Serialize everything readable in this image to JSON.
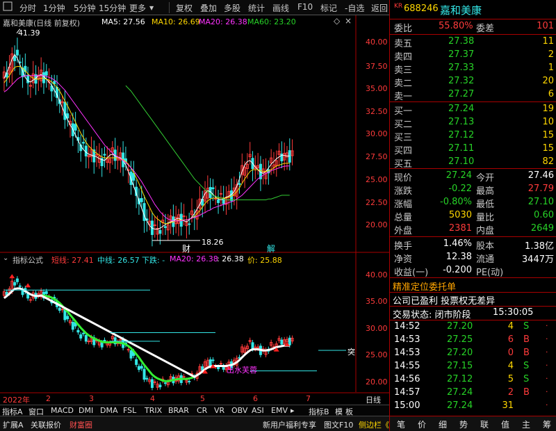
{
  "toolbar": {
    "left_icon": "square-icon",
    "items": [
      "分时",
      "1分钟",
      "5分钟",
      "15分钟",
      "更多",
      "复权",
      "叠加",
      "多股",
      "统计",
      "画线",
      "F10",
      "标记",
      "-自选",
      "返回"
    ]
  },
  "stock": {
    "badge": "KR",
    "code": "688246",
    "name": "嘉和美康"
  },
  "order_book": {
    "weibi_label": "委比",
    "weibi_value": "55.80%",
    "weicha_label": "委差",
    "weicha_value": "101",
    "asks": [
      {
        "label": "卖五",
        "price": "27.38",
        "vol": "11"
      },
      {
        "label": "卖四",
        "price": "27.37",
        "vol": "2"
      },
      {
        "label": "卖三",
        "price": "27.33",
        "vol": "1"
      },
      {
        "label": "卖二",
        "price": "27.32",
        "vol": "20"
      },
      {
        "label": "卖一",
        "price": "27.27",
        "vol": "6"
      }
    ],
    "bids": [
      {
        "label": "买一",
        "price": "27.24",
        "vol": "19"
      },
      {
        "label": "买二",
        "price": "27.13",
        "vol": "10"
      },
      {
        "label": "买三",
        "price": "27.12",
        "vol": "15"
      },
      {
        "label": "买四",
        "price": "27.11",
        "vol": "15"
      },
      {
        "label": "买五",
        "price": "27.10",
        "vol": "82"
      }
    ]
  },
  "quote": [
    {
      "l1": "现价",
      "v1": "27.24",
      "c1": "green",
      "l2": "今开",
      "v2": "27.46",
      "c2": "white"
    },
    {
      "l1": "涨跌",
      "v1": "-0.22",
      "c1": "green",
      "l2": "最高",
      "v2": "27.79",
      "c2": "red"
    },
    {
      "l1": "涨幅",
      "v1": "-0.80%",
      "c1": "green",
      "l2": "最低",
      "v2": "27.10",
      "c2": "green"
    },
    {
      "l1": "总量",
      "v1": "5030",
      "c1": "yellow",
      "l2": "量比",
      "v2": "0.60",
      "c2": "green"
    },
    {
      "l1": "外盘",
      "v1": "2381",
      "c1": "red",
      "l2": "内盘",
      "v2": "2649",
      "c2": "green"
    }
  ],
  "stats": [
    {
      "l1": "换手",
      "v1": "1.46%",
      "l2": "股本",
      "v2": "1.38亿"
    },
    {
      "l1": "净资",
      "v1": "12.38",
      "l2": "流通",
      "v2": "3447万"
    },
    {
      "l1": "收益(一)",
      "v1": "-0.200",
      "l2": "PE(动)",
      "v2": ""
    }
  ],
  "notices": {
    "title": "精准定位委托单",
    "line1": "公司已盈利 投票权无差异",
    "status_label": "交易状态: 闭市阶段",
    "status_time": "15:30:05"
  },
  "ticks": [
    {
      "time": "14:52",
      "price": "27.20",
      "vol": "4",
      "bs": "S"
    },
    {
      "time": "14:53",
      "price": "27.25",
      "vol": "6",
      "bs": "B"
    },
    {
      "time": "14:53",
      "price": "27.20",
      "vol": "0",
      "bs": "B"
    },
    {
      "time": "14:55",
      "price": "27.15",
      "vol": "4",
      "bs": "S"
    },
    {
      "time": "14:56",
      "price": "27.12",
      "vol": "5",
      "bs": "S"
    },
    {
      "time": "14:57",
      "price": "27.24",
      "vol": "2",
      "bs": "B"
    },
    {
      "time": "15:00",
      "price": "27.24",
      "vol": "31",
      "bs": ""
    }
  ],
  "right_tabs": [
    "笔",
    "价",
    "细",
    "势",
    "联",
    "值",
    "主",
    "筹"
  ],
  "main_chart": {
    "title": "嘉和美康(日线 前复权)",
    "ma5": "MA5: 27.56",
    "ma10": "MA10: 26.69",
    "ma20": "MA20: 26.38",
    "ma60": "MA60: 23.20",
    "high_marker": "41.39",
    "low_marker": "18.26",
    "tag_cai": "财",
    "tag_jie": "解",
    "y_ticks": [
      "40.00",
      "37.50",
      "35.00",
      "32.50",
      "30.00",
      "27.50",
      "25.00",
      "22.50",
      "20.00"
    ]
  },
  "sub_chart": {
    "title": "指标公式",
    "short_line": "短线: 27.41",
    "mid_line": "中线: 26.57",
    "down_trend": "下跌: -",
    "ma20": "MA20: 26.38",
    "extra": ": 26.38",
    "price": "价: 25.88",
    "annotation": "出水芙蓉",
    "right_label": "突",
    "y_ticks": [
      "40.00",
      "35.00",
      "30.00",
      "25.00",
      "20.00"
    ]
  },
  "x_axis": {
    "labels": [
      "2022年",
      "2",
      "3",
      "4",
      "5",
      "6",
      "7"
    ],
    "period": "日线"
  },
  "indicator_tabs": [
    "指标A",
    "窗口",
    "MACD",
    "DMI",
    "DMA",
    "FSL",
    "TRIX",
    "BRAR",
    "CR",
    "VR",
    "OBV",
    "ASI",
    "EMV"
  ],
  "indicator_tabs_right": [
    "指标B",
    "模",
    "板"
  ],
  "bottom_bar": [
    "扩展A",
    "关联报价",
    "财富圈"
  ],
  "bottom_right": [
    "新用户福利专享",
    "图文F10",
    "侧边栏《"
  ],
  "chart_data": {
    "type": "line",
    "title": "",
    "x": [
      0,
      1,
      2,
      3,
      4,
      5,
      6,
      7,
      8,
      9,
      10,
      11,
      12,
      13,
      14,
      15,
      16,
      17,
      18,
      19,
      20,
      21,
      22,
      23,
      24,
      25,
      26,
      27,
      28,
      29,
      30,
      31,
      32,
      33,
      34,
      35,
      36,
      37,
      38,
      39,
      40,
      41,
      42,
      43,
      44,
      45,
      46,
      47,
      48,
      49,
      50,
      51,
      52,
      53,
      54,
      55,
      56,
      57,
      58,
      59,
      60,
      61,
      62,
      63,
      64,
      65,
      66,
      67,
      68,
      69,
      70,
      71,
      72,
      73,
      74,
      75,
      76,
      77,
      78,
      79,
      80,
      81,
      82,
      83,
      84,
      85,
      86,
      87,
      88,
      89,
      90,
      91,
      92,
      93,
      94,
      95,
      96,
      97,
      98,
      99,
      100,
      101,
      102,
      103,
      104,
      105,
      106,
      107,
      108,
      109,
      110,
      111,
      112,
      113,
      114,
      115,
      116,
      117,
      118,
      119,
      120,
      121,
      122,
      123,
      124,
      125,
      126,
      127,
      128,
      129,
      130,
      131,
      132
    ],
    "series": [
      {
        "name": "MA5",
        "color": "#ffffff",
        "values": [
          36.0,
          36.6,
          37.3,
          38.1,
          38.6,
          38.2,
          37.5,
          36.8,
          36.1,
          35.7,
          35.6,
          35.8,
          36.0,
          36.3,
          36.4,
          36.2,
          35.9,
          35.6,
          35.2,
          34.7,
          34.2,
          33.5,
          32.8,
          32.1,
          31.5,
          30.9,
          30.4,
          29.8,
          29.2,
          28.6,
          28.2,
          27.9,
          27.7,
          27.6,
          27.5,
          27.4,
          27.2,
          27.1,
          27.0,
          27.3,
          27.6,
          27.7,
          27.5,
          27.4,
          27.3,
          27.0,
          26.5,
          25.8,
          25.0,
          24.2,
          23.4,
          22.6,
          21.8,
          21.0,
          20.4,
          19.9,
          19.6,
          19.5,
          19.5,
          19.6,
          19.8,
          20.0,
          20.2,
          20.3,
          20.4,
          20.6,
          20.7,
          20.5,
          20.4,
          20.3,
          20.5,
          20.8,
          21.2,
          21.7,
          22.2,
          22.8,
          23.4,
          23.7,
          23.6,
          23.3,
          23.0,
          22.8,
          22.7,
          22.8,
          23.0,
          23.1,
          23.3,
          23.6,
          24.2,
          25.0,
          25.8,
          26.5,
          26.9,
          27.0,
          26.7,
          26.3,
          26.0,
          25.7,
          25.6,
          25.8,
          26.2,
          26.6,
          26.9,
          27.2,
          27.4,
          27.6,
          27.56,
          27.5,
          27.5,
          27.5,
          27.5,
          27.5,
          27.5,
          27.5,
          27.5,
          27.5,
          27.5,
          27.5,
          27.5,
          27.5,
          27.5,
          27.5,
          27.5,
          27.5,
          27.5,
          27.5,
          27.5,
          27.5,
          27.5,
          27.5,
          27.5,
          27.5,
          27.5
        ]
      },
      {
        "name": "MA10",
        "color": "#ffd700",
        "values": [
          35.5,
          35.9,
          36.3,
          36.8,
          37.2,
          37.3,
          37.3,
          37.1,
          36.8,
          36.5,
          36.2,
          36.0,
          35.9,
          35.9,
          36.0,
          36.0,
          35.9,
          35.8,
          35.6,
          35.3,
          35.0,
          34.6,
          34.1,
          33.5,
          33.0,
          32.4,
          31.8,
          31.2,
          30.6,
          30.0,
          29.5,
          29.0,
          28.6,
          28.3,
          28.0,
          27.8,
          27.6,
          27.4,
          27.3,
          27.3,
          27.3,
          27.3,
          27.3,
          27.3,
          27.2,
          27.1,
          26.9,
          26.6,
          26.2,
          25.7,
          25.1,
          24.5,
          23.8,
          23.1,
          22.5,
          21.9,
          21.3,
          20.9,
          20.6,
          20.4,
          20.2,
          20.1,
          20.1,
          20.2,
          20.3,
          20.4,
          20.5,
          20.5,
          20.5,
          20.5,
          20.6,
          20.7,
          20.9,
          21.2,
          21.5,
          21.9,
          22.3,
          22.6,
          22.8,
          22.9,
          22.9,
          22.9,
          22.9,
          22.9,
          22.9,
          23.0,
          23.1,
          23.3,
          23.6,
          24.0,
          24.5,
          25.0,
          25.4,
          25.8,
          26.0,
          26.0,
          26.0,
          25.9,
          25.8,
          25.8,
          25.9,
          26.0,
          26.2,
          26.4,
          26.5,
          26.6,
          26.69,
          26.7,
          26.7,
          26.7,
          26.7,
          26.7,
          26.7,
          26.7,
          26.7,
          26.7,
          26.7,
          26.7,
          26.7,
          26.7,
          26.7,
          26.7,
          26.7,
          26.7,
          26.7,
          26.7,
          26.7,
          26.7,
          26.7,
          26.7,
          26.7,
          26.7,
          26.7
        ]
      },
      {
        "name": "MA20",
        "color": "#ff33ff",
        "values": [
          34.5,
          34.7,
          35.0,
          35.3,
          35.6,
          35.9,
          36.1,
          36.2,
          36.3,
          36.3,
          36.3,
          36.3,
          36.3,
          36.3,
          36.3,
          36.3,
          36.2,
          36.1,
          36.0,
          35.8,
          35.6,
          35.3,
          35.0,
          34.7,
          34.3,
          33.9,
          33.5,
          33.1,
          32.7,
          32.3,
          31.9,
          31.5,
          31.1,
          30.7,
          30.3,
          29.9,
          29.5,
          29.1,
          28.7,
          28.4,
          28.1,
          27.8,
          27.6,
          27.4,
          27.2,
          27.0,
          26.8,
          26.5,
          26.2,
          25.9,
          25.5,
          25.1,
          24.7,
          24.2,
          23.7,
          23.2,
          22.7,
          22.2,
          21.8,
          21.4,
          21.1,
          20.8,
          20.6,
          20.5,
          20.4,
          20.4,
          20.4,
          20.4,
          20.5,
          20.5,
          20.6,
          20.7,
          20.8,
          20.9,
          21.0,
          21.2,
          21.3,
          21.5,
          21.6,
          21.8,
          21.9,
          22.0,
          22.1,
          22.2,
          22.3,
          22.4,
          22.5,
          22.6,
          22.8,
          23.0,
          23.2,
          23.5,
          23.8,
          24.1,
          24.4,
          24.7,
          25.0,
          25.2,
          25.4,
          25.6,
          25.7,
          25.9,
          26.0,
          26.1,
          26.2,
          26.3,
          26.38,
          26.4,
          26.4,
          26.4,
          26.4,
          26.4,
          26.4,
          26.4,
          26.4,
          26.4,
          26.4,
          26.4,
          26.4,
          26.4,
          26.4,
          26.4,
          26.4,
          26.4,
          26.4,
          26.4,
          26.4,
          26.4,
          26.4,
          26.4,
          26.4,
          26.4,
          26.4
        ]
      },
      {
        "name": "MA60",
        "color": "#33cc33",
        "values": [
          null,
          null,
          null,
          null,
          null,
          null,
          null,
          null,
          null,
          null,
          null,
          null,
          null,
          null,
          null,
          null,
          null,
          null,
          null,
          null,
          null,
          null,
          null,
          null,
          null,
          null,
          null,
          null,
          null,
          null,
          null,
          null,
          null,
          null,
          null,
          null,
          null,
          null,
          null,
          null,
          null,
          null,
          null,
          null,
          null,
          null,
          35.2,
          34.9,
          34.6,
          34.2,
          33.8,
          33.4,
          33.0,
          32.6,
          32.2,
          31.8,
          31.4,
          31.0,
          30.6,
          30.2,
          29.8,
          29.4,
          29.0,
          28.6,
          28.2,
          27.8,
          27.4,
          27.0,
          26.6,
          26.2,
          25.8,
          25.4,
          25.0,
          24.7,
          24.4,
          24.1,
          23.8,
          23.6,
          23.4,
          23.2,
          23.1,
          23.0,
          22.9,
          22.8,
          22.7,
          22.7,
          22.7,
          22.7,
          22.7,
          22.7,
          22.7,
          22.7,
          22.7,
          22.7,
          22.7,
          22.7,
          22.7,
          22.7,
          22.7,
          22.7,
          22.8,
          22.8,
          22.9,
          23.0,
          23.1,
          23.2,
          23.2,
          23.2,
          23.2,
          23.2,
          23.2,
          23.2,
          23.2,
          23.2,
          23.2,
          23.2,
          23.2,
          23.2,
          23.2,
          23.2,
          23.2,
          23.2,
          23.2,
          23.2,
          23.2,
          23.2,
          23.2,
          23.2,
          23.2,
          23.2,
          23.2,
          23.2,
          23.2
        ]
      }
    ],
    "ylim": [
      18,
      42
    ],
    "xlabel": "",
    "ylabel": "",
    "grid": false
  }
}
